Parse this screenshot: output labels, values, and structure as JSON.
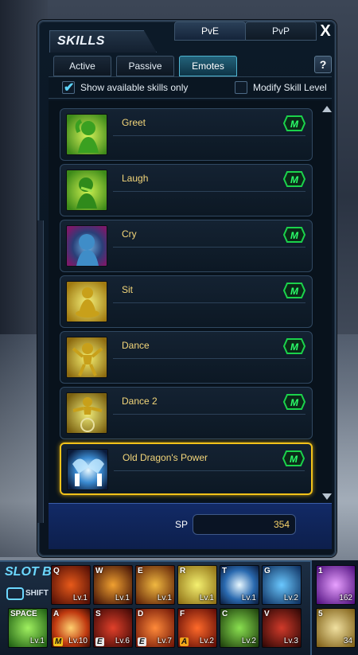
{
  "window": {
    "title": "SKILLS",
    "mode_tabs": [
      "PvE",
      "PvP"
    ],
    "active_mode": "PvE",
    "close_label": "X",
    "category_tabs": [
      "Active",
      "Passive",
      "Emotes"
    ],
    "active_category": "Emotes",
    "help_label": "?"
  },
  "options": {
    "show_available_label": "Show available skills only",
    "show_available_checked": true,
    "modify_level_label": "Modify Skill Level",
    "modify_level_checked": false
  },
  "skills": [
    {
      "name": "Greet",
      "badge": "M",
      "icon": "greet-icon"
    },
    {
      "name": "Laugh",
      "badge": "M",
      "icon": "laugh-icon"
    },
    {
      "name": "Cry",
      "badge": "M",
      "icon": "cry-icon"
    },
    {
      "name": "Sit",
      "badge": "M",
      "icon": "sit-icon"
    },
    {
      "name": "Dance",
      "badge": "M",
      "icon": "dance-icon"
    },
    {
      "name": "Dance 2",
      "badge": "M",
      "icon": "dance2-icon"
    },
    {
      "name": "Old Dragon's Power",
      "badge": "M",
      "icon": "dragon-power-icon",
      "selected": true
    }
  ],
  "sp": {
    "label": "SP",
    "value": "354"
  },
  "hotbar": {
    "slot_label": "SLOT B",
    "shift_label": "SHIFT",
    "row1": [
      {
        "key": "Q",
        "level": "Lv.1"
      },
      {
        "key": "W",
        "level": "Lv.1"
      },
      {
        "key": "E",
        "level": "Lv.1"
      },
      {
        "key": "R",
        "level": "Lv.1"
      },
      {
        "key": "T",
        "level": "Lv.1"
      },
      {
        "key": "G",
        "level": "Lv.2"
      }
    ],
    "row2": [
      {
        "key": "SPACE",
        "level": "Lv.1",
        "badge": ""
      },
      {
        "key": "A",
        "level": "Lv.10",
        "badge": "M"
      },
      {
        "key": "S",
        "level": "Lv.6",
        "badge": "E"
      },
      {
        "key": "D",
        "level": "Lv.7",
        "badge": "E"
      },
      {
        "key": "F",
        "level": "Lv.2",
        "badge": "A"
      },
      {
        "key": "C",
        "level": "Lv.2",
        "badge": ""
      },
      {
        "key": "V",
        "level": "Lv.3",
        "badge": ""
      }
    ],
    "items": [
      {
        "key": "1",
        "count": "162"
      },
      {
        "key": "5",
        "count": "34"
      }
    ]
  },
  "colors": {
    "accent": "#4fb4d0",
    "skill_name": "#f3d67a",
    "badge": "#1bd24b",
    "selected": "#f2c21a"
  }
}
